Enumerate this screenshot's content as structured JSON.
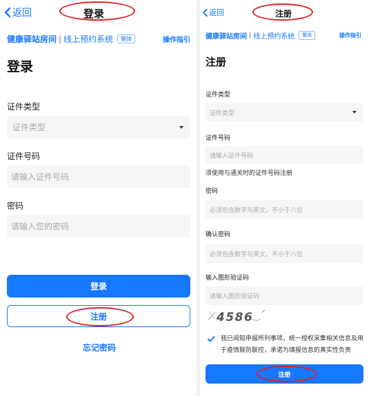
{
  "login": {
    "back_label": "返回",
    "title": "登录",
    "brand_name": "健康驿站房间",
    "brand_separator": "|",
    "brand_system": "线上预约系统",
    "lang_tag": "繁体",
    "guide_label": "操作指引",
    "heading": "登录",
    "id_type_label": "证件类型",
    "id_type_placeholder": "证件类型",
    "id_number_label": "证件号码",
    "id_number_placeholder": "请输入证件号码",
    "password_label": "密码",
    "password_placeholder": "请输入您的密码",
    "login_button": "登录",
    "register_button": "注册",
    "forgot_link": "忘记密码"
  },
  "register": {
    "back_label": "返回",
    "title": "注册",
    "brand_name": "健康驿站房间",
    "brand_separator": "|",
    "brand_system": "线上预约系统",
    "lang_tag": "繁体",
    "guide_label": "操作指引",
    "heading": "注册",
    "id_type_label": "证件类型",
    "id_type_placeholder": "证件类型",
    "id_number_label": "证件号码",
    "id_number_placeholder": "请输入证件号码",
    "id_number_hint": "须使用与通关时的证件号码注册",
    "password_label": "密码",
    "password_placeholder": "必须包含数字与英文，不小于八位",
    "confirm_label": "确认密码",
    "confirm_placeholder": "必须包含数字与英文，不小于八位",
    "captcha_label": "输入图形验证码",
    "captcha_placeholder": "请输入图形验证码",
    "captcha_text": "4586",
    "agree_text": "我已阅知申报所列事项，统一授权采集相关信息及用于疫情联防联控，承诺为填报信息的真实性负责",
    "agree_checked": true,
    "register_button": "注册"
  },
  "colors": {
    "accent": "#1677ff",
    "annotation": "#e02020",
    "field_bg": "#f5f6f8"
  }
}
